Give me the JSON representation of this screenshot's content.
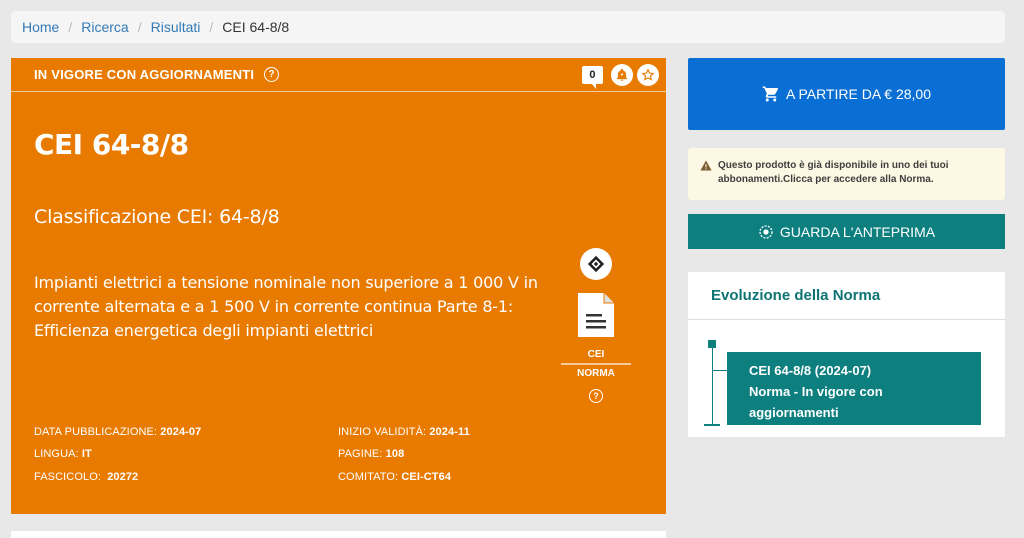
{
  "breadcrumb": {
    "items": [
      "Home",
      "Ricerca",
      "Risultati"
    ],
    "current": "CEI 64-8/8",
    "separator": "/"
  },
  "status": {
    "label": "IN VIGORE CON AGGIORNAMENTI",
    "help": "?",
    "counter": "0"
  },
  "norma": {
    "code": "CEI 64-8/8",
    "classification": "Classificazione CEI: 64-8/8",
    "description": "Impianti elettrici a tensione nominale non superiore a 1 000 V in corrente alternata e a 1 500 V in corrente continua Parte 8-1: Efficienza energetica degli impianti elettrici",
    "side_label_1": "CEI",
    "side_label_2": "NORMA",
    "side_help": "?"
  },
  "meta": {
    "data_pubblicazione_label": "DATA PUBBLICAZIONE:",
    "data_pubblicazione": "2024-07",
    "inizio_validita_label": "INIZIO VALIDITÀ:",
    "inizio_validita": "2024-11",
    "lingua_label": "LINGUA:",
    "lingua": "IT",
    "pagine_label": "PAGINE:",
    "pagine": "108",
    "fascicolo_label": "FASCICOLO:",
    "fascicolo": "20272",
    "comitato_label": "COMITATO:",
    "comitato": "CEI-CT64"
  },
  "sidebar": {
    "buy_label": "A PARTIRE DA € 28,00",
    "notice": "Questo prodotto è già disponibile in uno dei tuoi abbonamenti.Clicca per accedere alla Norma.",
    "preview_label": "GUARDA L'ANTEPRIMA",
    "evolution_title": "Evoluzione della Norma",
    "evolution_line1": "CEI 64-8/8 (2024-07)",
    "evolution_line2": "Norma - In vigore con",
    "evolution_line3": "aggiornamenti"
  },
  "colors": {
    "status_orange": "#e87a00",
    "buy_blue": "#0a6fd4",
    "teal": "#0e7f7f",
    "notice_bg": "#fcf8e3"
  },
  "icons": [
    "cart-icon",
    "warning-icon",
    "eye-icon",
    "bell-icon",
    "star-icon",
    "diamond-icon",
    "document-icon",
    "help-icon"
  ]
}
